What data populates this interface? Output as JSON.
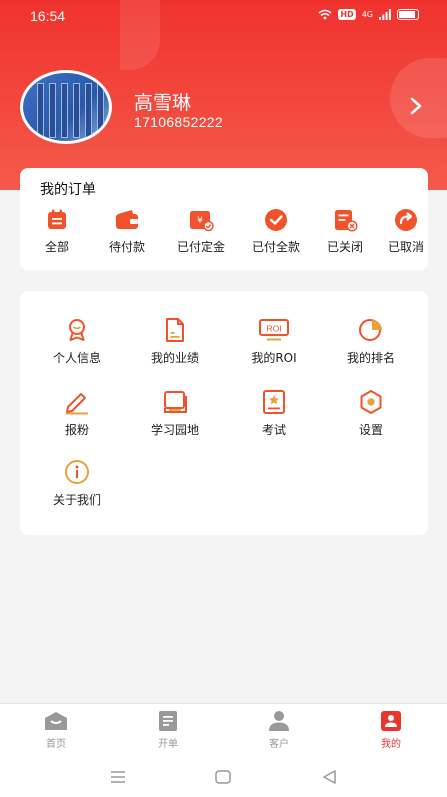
{
  "status_bar": {
    "time": "16:54",
    "hd": "HD",
    "network": "4G",
    "battery": "88"
  },
  "profile": {
    "name": "高雪琳",
    "phone": "17106852222"
  },
  "orders": {
    "title": "我的订单",
    "items": [
      {
        "label": "全部",
        "icon": "calendar-icon"
      },
      {
        "label": "待付款",
        "icon": "wallet-icon"
      },
      {
        "label": "已付定金",
        "icon": "deposit-icon"
      },
      {
        "label": "已付全款",
        "icon": "check-circle-icon"
      },
      {
        "label": "已关闭",
        "icon": "doc-close-icon"
      },
      {
        "label": "已取消",
        "icon": "cancel-arrow-icon"
      }
    ]
  },
  "services": {
    "items": [
      {
        "label": "个人信息",
        "icon": "medal-icon"
      },
      {
        "label": "我的业绩",
        "icon": "document-icon"
      },
      {
        "label": "我的ROI",
        "icon": "roi-icon",
        "icon_text": "ROI"
      },
      {
        "label": "我的排名",
        "icon": "pie-chart-icon"
      },
      {
        "label": "报粉",
        "icon": "pencil-icon"
      },
      {
        "label": "学习园地",
        "icon": "book-icon"
      },
      {
        "label": "考试",
        "icon": "exam-icon"
      },
      {
        "label": "设置",
        "icon": "settings-hexagon-icon"
      },
      {
        "label": "关于我们",
        "icon": "info-icon"
      }
    ]
  },
  "tabbar": {
    "tabs": [
      {
        "label": "首页",
        "icon": "home-icon",
        "active": false
      },
      {
        "label": "开单",
        "icon": "order-form-icon",
        "active": false
      },
      {
        "label": "客户",
        "icon": "person-icon",
        "active": false
      },
      {
        "label": "我的",
        "icon": "profile-card-icon",
        "active": true
      }
    ]
  },
  "colors": {
    "brand_red": "#f0322e",
    "accent": "#e8352d",
    "icon_orange": "#f0532c",
    "gold": "#e9a13b"
  }
}
